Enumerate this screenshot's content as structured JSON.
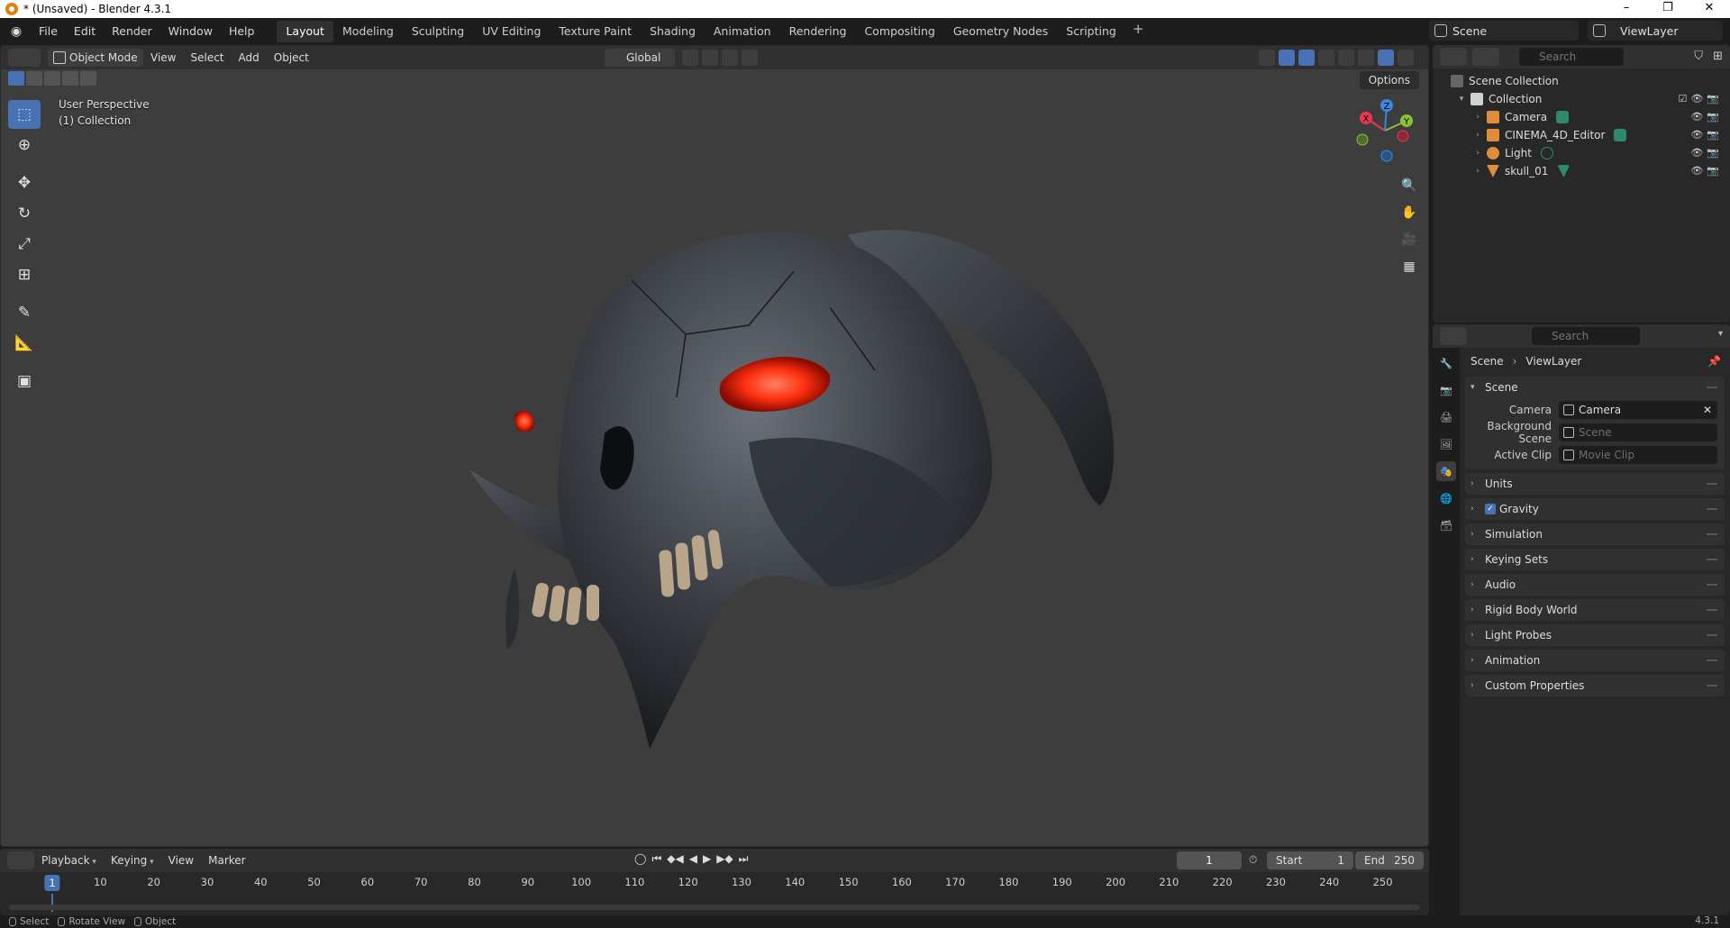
{
  "window": {
    "title": "* (Unsaved) - Blender 4.3.1",
    "controls": [
      "–",
      "❐",
      "✕"
    ]
  },
  "topbar": {
    "menus": [
      "File",
      "Edit",
      "Render",
      "Window",
      "Help"
    ],
    "workspaces": [
      "Layout",
      "Modeling",
      "Sculpting",
      "UV Editing",
      "Texture Paint",
      "Shading",
      "Animation",
      "Rendering",
      "Compositing",
      "Geometry Nodes",
      "Scripting"
    ],
    "active_workspace": "Layout",
    "add_tab": "+",
    "scene_name": "Scene",
    "view_layer": "ViewLayer"
  },
  "viewport": {
    "mode": "Object Mode",
    "menus": [
      "View",
      "Select",
      "Add",
      "Object"
    ],
    "transform_orientation": "Global",
    "options_label": "Options",
    "info_line1": "User Perspective",
    "info_line2": "(1) Collection",
    "gizmo_axes": {
      "x": "X",
      "y": "Y",
      "z": "Z"
    },
    "colors": {
      "x_axis": "#e8384f",
      "y_axis": "#8bc13a",
      "z_axis": "#3b88e0",
      "accent": "#4772b3",
      "eye_glow": "#ff3010"
    }
  },
  "outliner": {
    "search_placeholder": "Search",
    "root": "Scene Collection",
    "collection": "Collection",
    "items": [
      {
        "name": "Camera",
        "icon": "camera-icon",
        "data_icon": "camera-data-icon"
      },
      {
        "name": "CINEMA_4D_Editor",
        "icon": "camera-icon",
        "data_icon": "camera-data-icon"
      },
      {
        "name": "Light",
        "icon": "light-icon",
        "data_icon": "light-data-icon"
      },
      {
        "name": "skull_01",
        "icon": "mesh-icon",
        "data_icon": "mesh-data-icon"
      }
    ]
  },
  "properties": {
    "search_placeholder": "Search",
    "breadcrumb": {
      "scene": "Scene",
      "view_layer": "ViewLayer"
    },
    "scene_panel": {
      "title": "Scene",
      "rows": [
        {
          "label": "Camera",
          "value": "Camera",
          "empty": false
        },
        {
          "label": "Background Scene",
          "value": "Scene",
          "empty": true
        },
        {
          "label": "Active Clip",
          "value": "Movie Clip",
          "empty": true
        }
      ]
    },
    "panels": [
      "Units",
      "Gravity",
      "Simulation",
      "Keying Sets",
      "Audio",
      "Rigid Body World",
      "Light Probes",
      "Animation",
      "Custom Properties"
    ],
    "gravity_enabled": true
  },
  "timeline": {
    "menus": [
      "Playback",
      "Keying",
      "View",
      "Marker"
    ],
    "current_frame": "1",
    "start_label": "Start",
    "start": "1",
    "end_label": "End",
    "end": "250",
    "ticks": [
      "10",
      "20",
      "30",
      "40",
      "50",
      "60",
      "70",
      "80",
      "90",
      "100",
      "110",
      "120",
      "130",
      "140",
      "150",
      "160",
      "170",
      "180",
      "190",
      "200",
      "210",
      "220",
      "230",
      "240",
      "250"
    ],
    "playback_icons": [
      "⏮",
      "◆◀",
      "◀",
      "▶",
      "▶◆",
      "⏭"
    ]
  },
  "statusbar": {
    "items": [
      "Select",
      "Rotate View",
      "Object"
    ],
    "version": "4.3.1"
  }
}
